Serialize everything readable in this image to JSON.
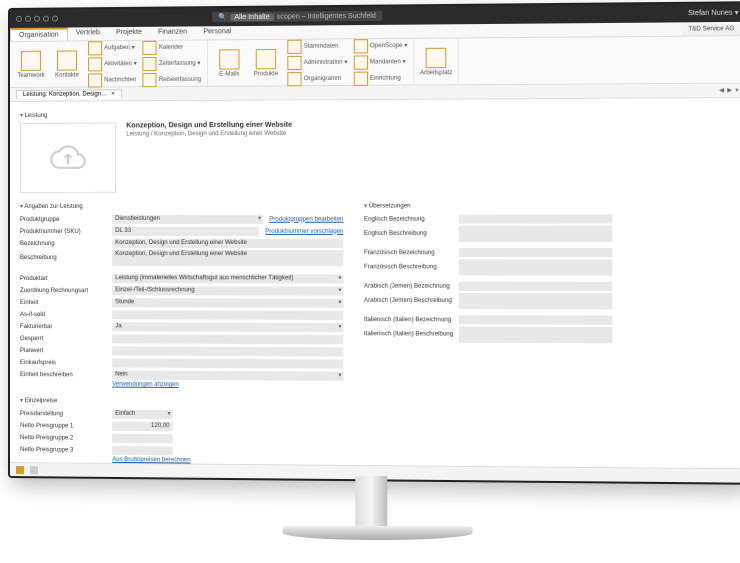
{
  "titlebar": {
    "search_pill": "Alle Inhalte",
    "search_text": "scopen – Intelligentes Suchfeld",
    "user": "Stefan Nunes ▾"
  },
  "orgbox": "T&D Service AG",
  "menubar": [
    "Organisation",
    "Vertrieb",
    "Projekte",
    "Finanzen",
    "Personal"
  ],
  "ribbon": {
    "g1_big": [
      "Teamwork",
      "Kontakte"
    ],
    "g1_col": [
      "Aufgaben ▾",
      "Aktivitäten ▾",
      "Nachrichten"
    ],
    "g1_col2": [
      "Kalender",
      "Zeiterfassung ▾",
      "Reiseerfassung"
    ],
    "g2_big": [
      "E-Mails",
      "Produkte"
    ],
    "g2_col": [
      "Stammdaten",
      "Administration ▾",
      "Organigramm"
    ],
    "g3_col": [
      "OpenScope ▾",
      "Mandanten ▾",
      "Einrichtung"
    ],
    "g4": "Arbeitsplatz"
  },
  "doctab": "Leistung: Konzeption, Design…",
  "main": {
    "section_leistung": "Leistung",
    "title": "Konzeption, Design und Erstellung einer Website",
    "subtitle": "Leistung / Konzeption, Design und Erstellung einer Website",
    "section_angaben": "Angaben zur Leistung",
    "produktgruppe_lbl": "Produktgruppe",
    "produktgruppe_val": "Dienstleistungen",
    "produktgruppe_link": "Produktgruppen bearbeiten",
    "sku_lbl": "Produktnummer (SKU)",
    "sku_val": "DL 33",
    "sku_link": "Produktnummer vorschlagen",
    "bezeichnung_lbl": "Bezeichnung",
    "bezeichnung_val": "Konzeption, Design und Erstellung einer Website",
    "beschreibung_lbl": "Beschreibung",
    "beschreibung_val": "Konzeption, Design und Erstellung einer Website",
    "produktart_lbl": "Produktart",
    "produktart_val": "Leistung (immaterielles Wirtschaftsgut aus menschlicher Tätigkeit)",
    "zuordnung_lbl": "Zuordnung Rechnungsart",
    "zuordnung_val": "Einzel-/Teil-/Schlussrechnung",
    "einheit_lbl": "Einheit",
    "einheit_val": "Stunde",
    "asifsold_lbl": "As-if-sold",
    "asifsold_val": "",
    "fakturierbar_lbl": "Fakturierbar",
    "fakturierbar_val": "Ja",
    "gesperrt_lbl": "Gesperrt",
    "gesperrt_val": "",
    "planwert_lbl": "Planwert",
    "planwert_val": "",
    "einkaufspreis_lbl": "Einkaufspreis",
    "einkaufspreis_val": "",
    "einheitbeschr_lbl": "Einheit beschreiben",
    "einheitbeschr_val": "Nein",
    "verwendungen_link": "Verwendungen anzeigen",
    "section_einzelpreise": "Einzelpreise",
    "preisdarstellung_lbl": "Preisdarstellung",
    "preisdarstellung_val": "Einfach",
    "netto1_lbl": "Netto Preisgruppe 1",
    "netto1_val": "120,00",
    "netto2_lbl": "Netto Preisgruppe 2",
    "netto2_val": "",
    "netto3_lbl": "Netto Preisgruppe 3",
    "netto3_val": "",
    "brutto_link": "Aus Bruttopreisen berechnen"
  },
  "trans": {
    "section": "Übersetzungen",
    "en_bez": "Englisch Bezeichnung",
    "en_besch": "Englisch Beschreibung",
    "fr_bez": "Französisch Bezeichnung",
    "fr_besch": "Französisch Beschreibung",
    "ar_bez": "Arabisch (Jemen) Bezeichnung",
    "ar_besch": "Arabisch (Jemen) Beschreibung",
    "it_bez": "Italienisch (Italien) Bezeichnung",
    "it_besch": "Italienisch (Italien) Beschreibung"
  }
}
